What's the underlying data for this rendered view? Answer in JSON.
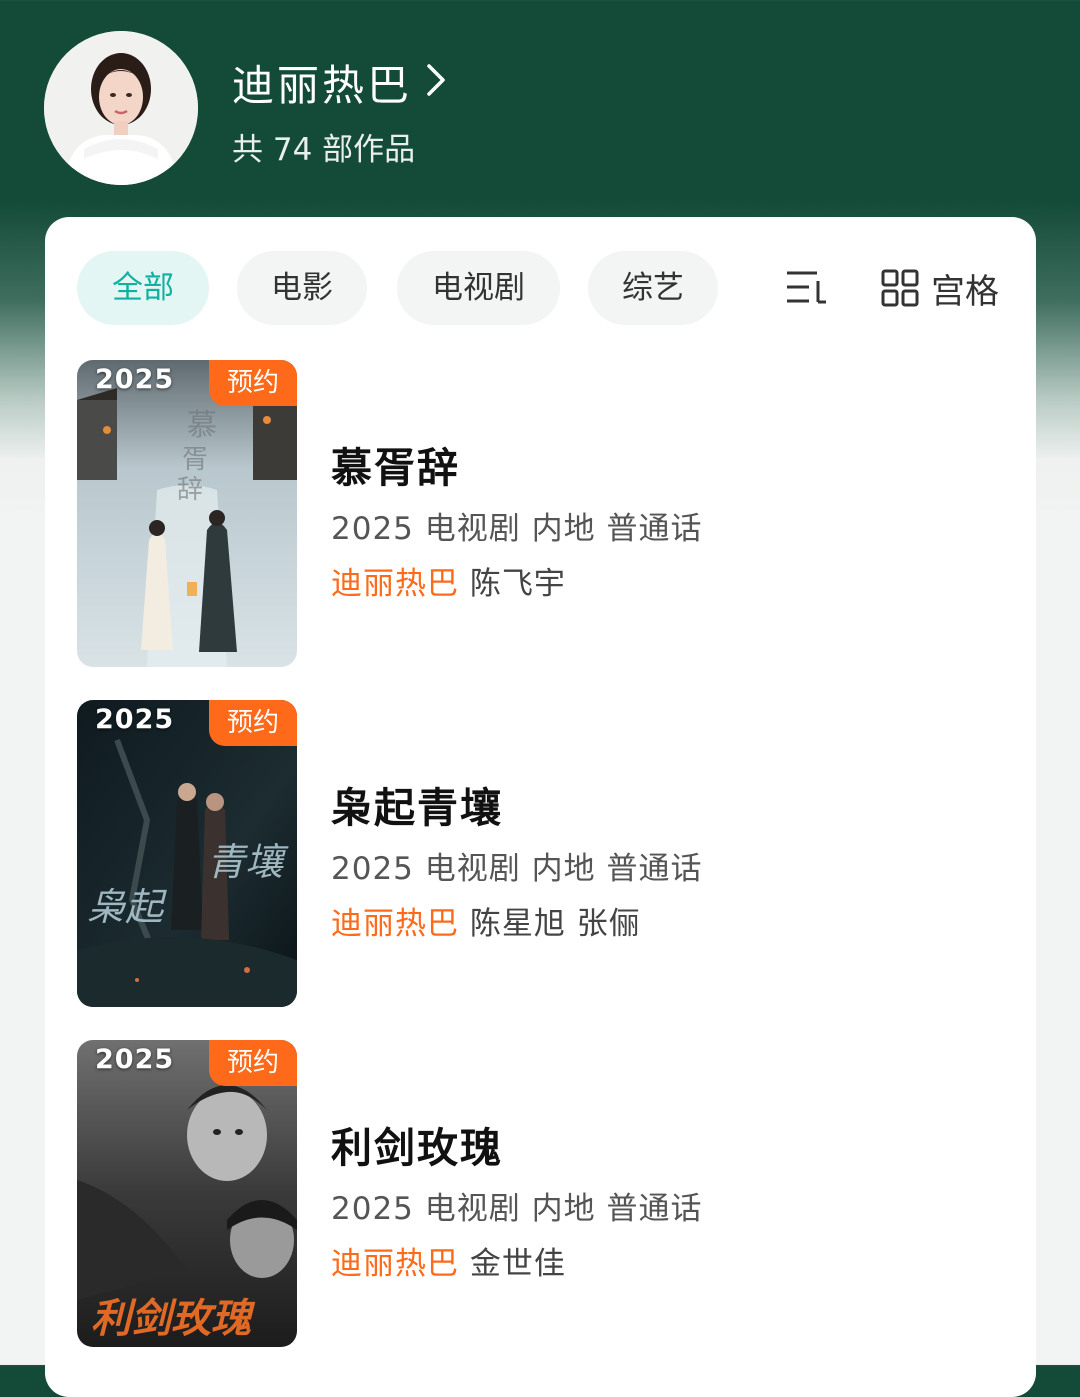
{
  "header": {
    "artist_name": "迪丽热巴",
    "work_count": "共 74 部作品"
  },
  "filters": {
    "tabs": [
      {
        "label": "全部",
        "active": true
      },
      {
        "label": "电影",
        "active": false
      },
      {
        "label": "电视剧",
        "active": false
      },
      {
        "label": "综艺",
        "active": false
      }
    ],
    "sort_icon": "sort-icon",
    "grid_label": "宫格",
    "grid_icon": "grid-icon"
  },
  "works": [
    {
      "year": "2025",
      "badge": "预约",
      "title": "慕胥辞",
      "meta": "2025 电视剧 内地 普通话",
      "lead": "迪丽热巴",
      "others": "陈飞宇"
    },
    {
      "year": "2025",
      "badge": "预约",
      "title": "枭起青壤",
      "meta": "2025 电视剧 内地 普通话",
      "lead": "迪丽热巴",
      "others": "陈星旭 张俪"
    },
    {
      "year": "2025",
      "badge": "预约",
      "title": "利剑玫瑰",
      "meta": "2025 电视剧 内地 普通话",
      "lead": "迪丽热巴",
      "others": "金世佳"
    }
  ],
  "colors": {
    "header_green": "#134a38",
    "accent_teal": "#10b1a0",
    "accent_orange": "#ff6a1a"
  }
}
